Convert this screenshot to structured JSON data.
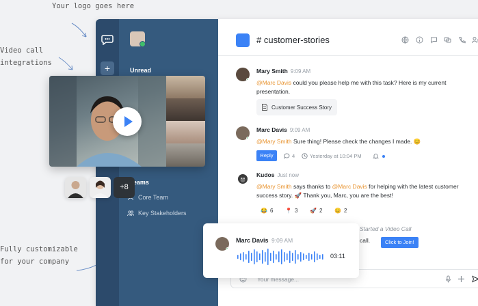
{
  "annotations": {
    "logo": "Your logo goes here",
    "video_line1": "Video call",
    "video_line2": "integrations",
    "custom_line1": "Fully customizable",
    "custom_line2": "for your company"
  },
  "sidebar": {
    "unread": "Unread",
    "teams": "Teams",
    "items": [
      {
        "label": "Core Team"
      },
      {
        "label": "Key Stakeholders"
      }
    ]
  },
  "header": {
    "channel": "# customer-stories"
  },
  "messages": {
    "m1": {
      "name": "Mary Smith",
      "time": "9:09 AM",
      "mention": "@Marc Davis",
      "text": " could you please help me with this task? Here is my current presentation.",
      "file": "Customer Success Story"
    },
    "m2": {
      "name": "Marc Davis",
      "time": "9:09 AM",
      "mention": "@Mary Smith",
      "text": " Sure thing! Please check the changes I made. 😊",
      "reply": "Reply",
      "replies": "4",
      "stamp": "Yesterday at 10:04 PM"
    },
    "m3": {
      "name": "Kudos",
      "time": "Just now",
      "mention1": "@Mary Smith",
      "mid": " says thanks to ",
      "mention2": "@Marc Davis",
      "text": " for helping with the latest customer success story. 🚀 Thank you, Marc, you are the best!",
      "reactions": [
        {
          "emoji": "😂",
          "count": "6"
        },
        {
          "emoji": "📍",
          "count": "3"
        },
        {
          "emoji": "🚀",
          "count": "2"
        },
        {
          "emoji": "😊",
          "count": "2"
        }
      ]
    },
    "call": {
      "status": "Started a Video Call",
      "text": "call.",
      "join": "Click to Join!"
    }
  },
  "composer": {
    "placeholder": "Your message..."
  },
  "participants": {
    "more": "+8"
  },
  "voice": {
    "name": "Marc Davis",
    "time": "9:09 AM",
    "duration": "03:11"
  },
  "colors": {
    "accent": "#3b82f6",
    "sidebar": "#355a7e",
    "rail": "#2c4a6b",
    "mention": "#e8932f",
    "online": "#3fbf6a"
  }
}
